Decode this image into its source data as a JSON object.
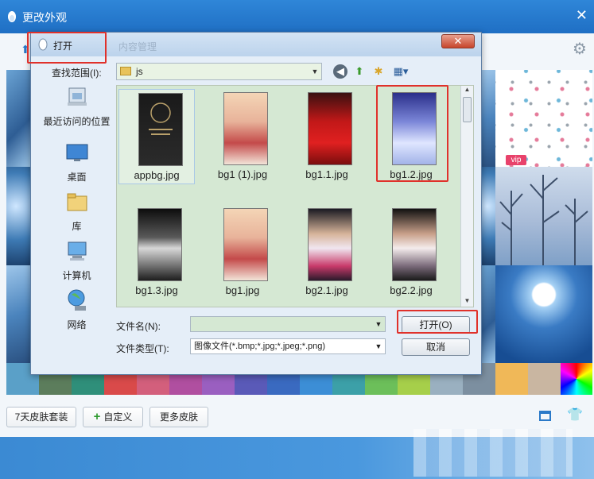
{
  "skin_window": {
    "title": "更改外观",
    "close_glyph": "✕"
  },
  "bottom_bar": {
    "buttons": [
      "7天皮肤套装",
      "自定义",
      "更多皮肤"
    ]
  },
  "color_strip": [
    "#5aa0c8",
    "#5c7d5c",
    "#2f8f7a",
    "#d94a4a",
    "#d35f7c",
    "#b04fa0",
    "#9a5fc0",
    "#5a5ab8",
    "#3a6ac0",
    "#3c8ed6",
    "#3ca0a8",
    "#6cbf5a",
    "#a6cf4a",
    "#9ab0c0",
    "#7c8fa0"
  ],
  "dialog": {
    "title": "打开",
    "ghost_text": "内容管理",
    "close_glyph": "✕",
    "look_in_label": "查找范围(I):",
    "look_in_value": "js",
    "places": [
      "最近访问的位置",
      "桌面",
      "库",
      "计算机",
      "网络"
    ],
    "files": [
      {
        "name": "appbg.jpg"
      },
      {
        "name": "bg1 (1).jpg"
      },
      {
        "name": "bg1.1.jpg"
      },
      {
        "name": "bg1.2.jpg"
      },
      {
        "name": "bg1.3.jpg"
      },
      {
        "name": "bg1.jpg"
      },
      {
        "name": "bg2.1.jpg"
      },
      {
        "name": "bg2.2.jpg"
      }
    ],
    "filename_label": "文件名(N):",
    "filename_value": "",
    "filetype_label": "文件类型(T):",
    "filetype_value": "图像文件(*.bmp;*.jpg;*.jpeg;*.png)",
    "open_button": "打开(O)",
    "cancel_button": "取消"
  },
  "colors": {
    "highlight": "#e0312b",
    "title_blue": "#1f6fc4",
    "file_area": "#d5e8d3"
  }
}
